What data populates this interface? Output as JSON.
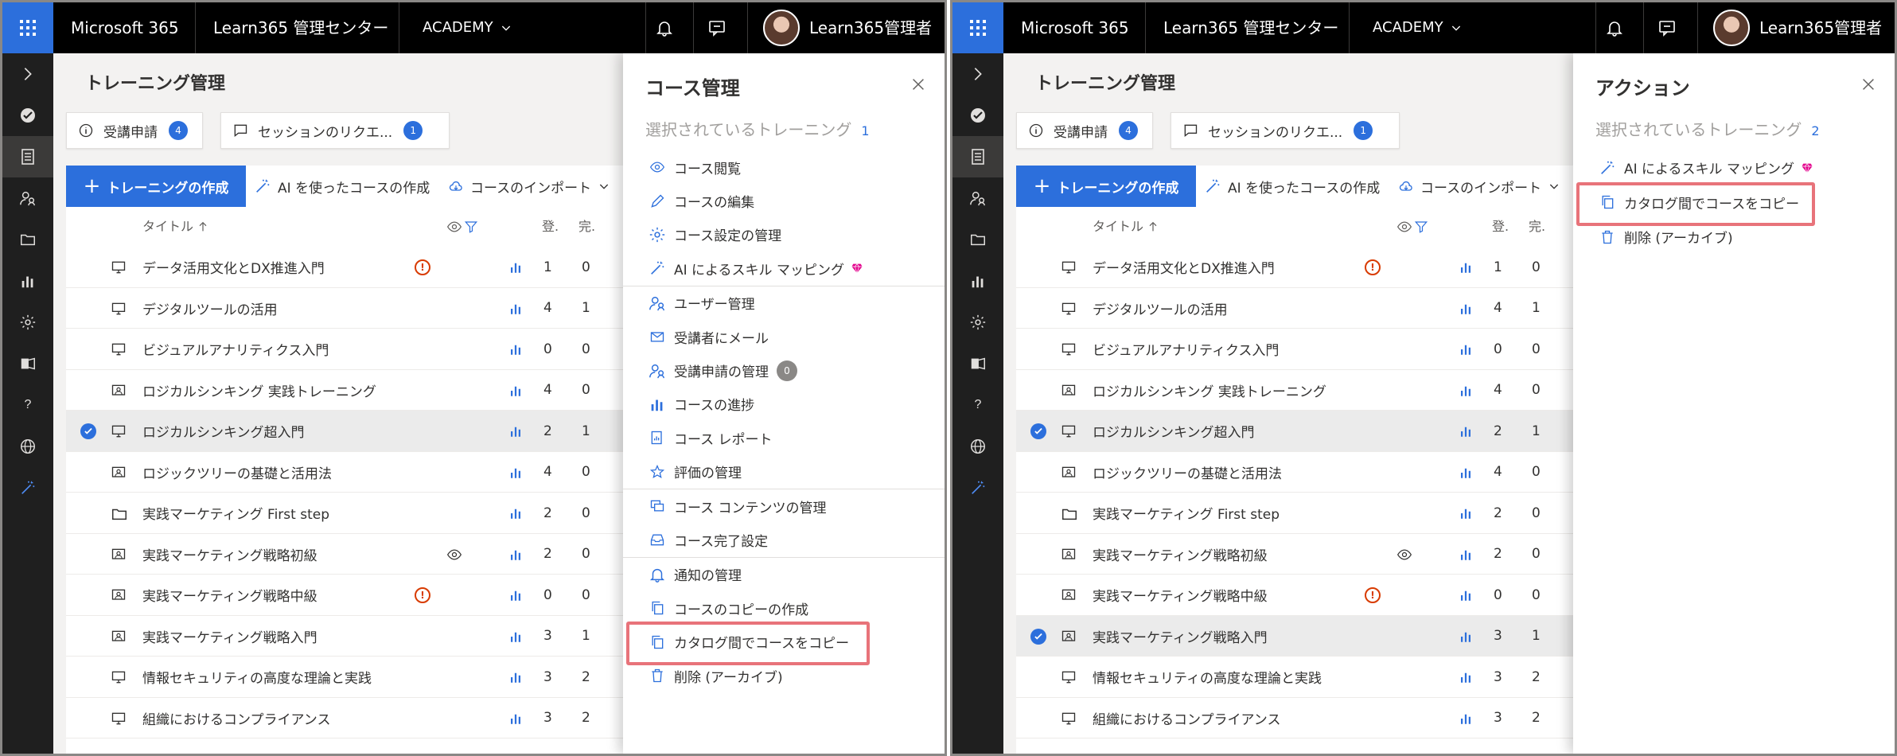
{
  "colors": {
    "accent": "#2c6fdc",
    "highlight": "#e8737a",
    "warning": "#d83b01",
    "topbar": "#000000",
    "rail": "#1f1f1f"
  },
  "topbar": {
    "app_name": "Microsoft 365",
    "center_name": "Learn365 管理センター",
    "tenant": "ACADEMY",
    "user_name": "Learn365管理者",
    "icons": [
      "waffle-icon",
      "bell-icon",
      "feedback-icon",
      "chevron-down-icon"
    ]
  },
  "rail": {
    "icons": [
      "expand-icon",
      "check-icon",
      "document-icon",
      "people-icon",
      "folder-icon",
      "chart-icon",
      "gear-icon",
      "admin-icon",
      "help-icon",
      "globe-icon",
      "wand-icon"
    ]
  },
  "main": {
    "title": "トレーニング管理",
    "cards": [
      {
        "label": "受講申請",
        "count": "4"
      },
      {
        "label": "セッションのリクエ...",
        "count": "1"
      }
    ],
    "commands": {
      "create": "トレーニングの作成",
      "ai_create": "AI を使ったコースの作成",
      "import": "コースのインポート"
    },
    "columns": {
      "title": "タイトル",
      "enrolled": "登.",
      "completed": "完."
    },
    "rows": [
      {
        "title": "データ活用文化とDX推進入門",
        "type": "monitor",
        "warn": true,
        "eye": false,
        "enrolled": "1",
        "completed": "0"
      },
      {
        "title": "デジタルツールの活用",
        "type": "monitor",
        "warn": false,
        "eye": false,
        "enrolled": "4",
        "completed": "1"
      },
      {
        "title": "ビジュアルアナリティクス入門",
        "type": "monitor",
        "warn": false,
        "eye": false,
        "enrolled": "0",
        "completed": "0"
      },
      {
        "title": "ロジカルシンキング 実践トレーニング",
        "type": "classroom",
        "warn": false,
        "eye": false,
        "enrolled": "4",
        "completed": "0"
      },
      {
        "title": "ロジカルシンキング超入門",
        "type": "monitor",
        "warn": false,
        "eye": false,
        "enrolled": "2",
        "completed": "1"
      },
      {
        "title": "ロジックツリーの基礎と活用法",
        "type": "classroom",
        "warn": false,
        "eye": false,
        "enrolled": "4",
        "completed": "0"
      },
      {
        "title": "実践マーケティング First step",
        "type": "folder",
        "warn": false,
        "eye": false,
        "enrolled": "2",
        "completed": "0"
      },
      {
        "title": "実践マーケティング戦略初級",
        "type": "classroom",
        "warn": false,
        "eye": true,
        "enrolled": "2",
        "completed": "0"
      },
      {
        "title": "実践マーケティング戦略中級",
        "type": "classroom",
        "warn": true,
        "eye": false,
        "enrolled": "0",
        "completed": "0"
      },
      {
        "title": "実践マーケティング戦略入門",
        "type": "classroom",
        "warn": false,
        "eye": false,
        "enrolled": "3",
        "completed": "1"
      },
      {
        "title": "情報セキュリティの高度な理論と実践",
        "type": "monitor",
        "warn": false,
        "eye": false,
        "enrolled": "3",
        "completed": "2"
      },
      {
        "title": "組織におけるコンプライアンス",
        "type": "monitor",
        "warn": false,
        "eye": false,
        "enrolled": "3",
        "completed": "2"
      }
    ]
  },
  "screens": [
    {
      "selected_rows": [
        4
      ]
    },
    {
      "selected_rows": [
        4,
        9
      ]
    }
  ],
  "course_panel": {
    "title": "コース管理",
    "subtitle": "選択されているトレーニング",
    "selected_count": "1",
    "items": [
      {
        "label": "コース閲覧",
        "icon": "eye-icon"
      },
      {
        "label": "コースの編集",
        "icon": "pencil-icon"
      },
      {
        "label": "コース設定の管理",
        "icon": "gear-icon"
      },
      {
        "label": "AI によるスキル マッピング",
        "icon": "wand-icon",
        "gem": true,
        "sep_after": true
      },
      {
        "label": "ユーザー管理",
        "icon": "people-icon"
      },
      {
        "label": "受講者にメール",
        "icon": "mail-icon"
      },
      {
        "label": "受講申請の管理",
        "icon": "people-icon",
        "badge": "0"
      },
      {
        "label": "コースの進捗",
        "icon": "chart-icon"
      },
      {
        "label": "コース レポート",
        "icon": "report-icon"
      },
      {
        "label": "評価の管理",
        "icon": "star-icon",
        "sep_after": true
      },
      {
        "label": "コース コンテンツの管理",
        "icon": "content-icon"
      },
      {
        "label": "コース完了設定",
        "icon": "inbox-icon",
        "sep_after": true
      },
      {
        "label": "通知の管理",
        "icon": "bell-icon"
      },
      {
        "label": "コースのコピーの作成",
        "icon": "copy-icon"
      },
      {
        "label": "カタログ間でコースをコピー",
        "icon": "copy-icon",
        "highlight": true
      },
      {
        "label": "削除 (アーカイブ)",
        "icon": "trash-icon"
      }
    ]
  },
  "action_panel": {
    "title": "アクション",
    "subtitle": "選択されているトレーニング",
    "selected_count": "2",
    "items": [
      {
        "label": "AI によるスキル マッピング",
        "icon": "wand-icon",
        "gem": true
      },
      {
        "label": "カタログ間でコースをコピー",
        "icon": "copy-icon",
        "highlight": true
      },
      {
        "label": "削除 (アーカイブ)",
        "icon": "trash-icon"
      }
    ]
  }
}
